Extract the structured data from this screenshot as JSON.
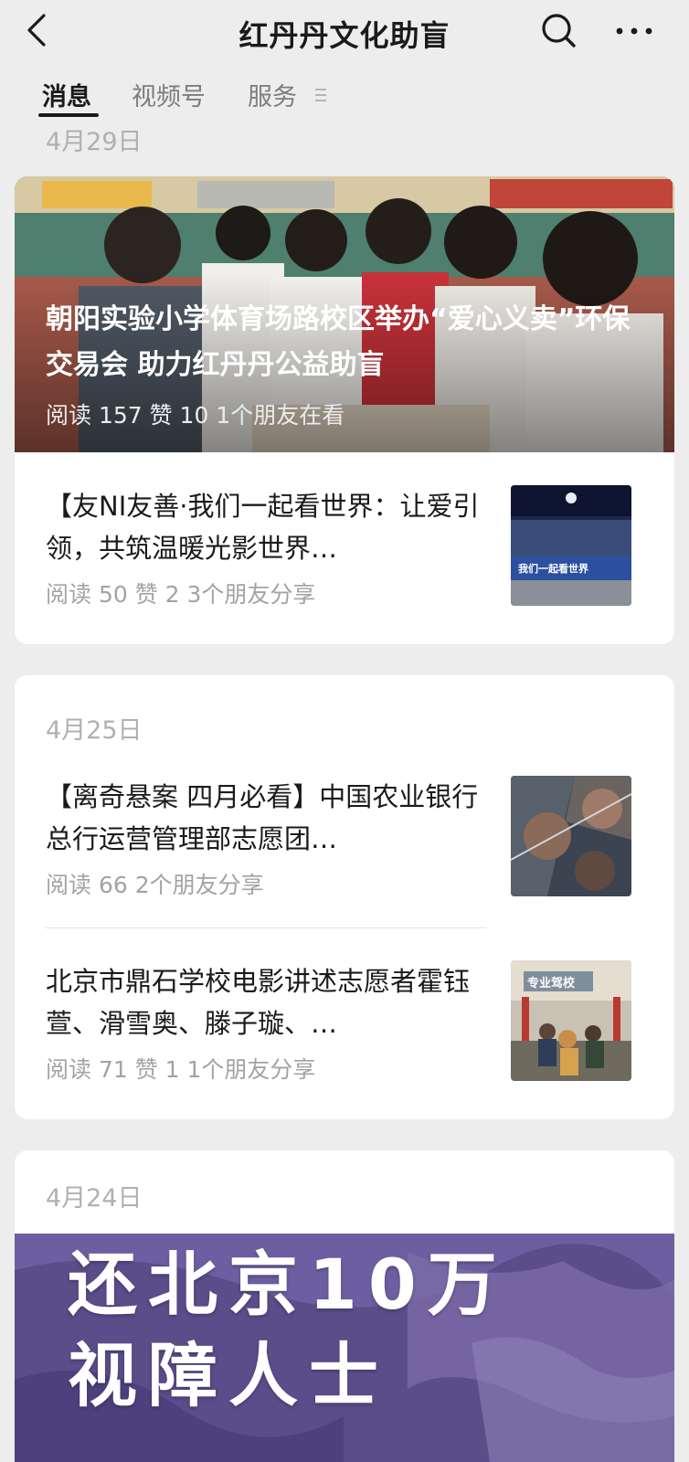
{
  "header": {
    "title": "红丹丹文化助盲",
    "back_icon": "chevron-left-icon",
    "search_icon": "search-icon",
    "more_icon": "more-dots-icon"
  },
  "tabs": [
    {
      "label": "消息",
      "active": true
    },
    {
      "label": "视频号",
      "active": false
    },
    {
      "label": "服务",
      "active": false
    }
  ],
  "feed": [
    {
      "date": "4月29日",
      "featured": {
        "title": "朝阳实验小学体育场路校区举办“爱心义卖”环保交易会 助力红丹丹公益助盲",
        "meta": "阅读 157  赞 10  1个朋友在看"
      },
      "articles": [
        {
          "title": "【友NI友善·我们一起看世界：让爱引领，共筑温暖光影世界…",
          "meta": "阅读 50  赞 2  3个朋友分享",
          "thumb_text": "我们一起看世界"
        }
      ]
    },
    {
      "date": "4月25日",
      "articles": [
        {
          "title": "【离奇悬案 四月必看】中国农业银行总行运营管理部志愿团…",
          "meta": "阅读 66  2个朋友分享"
        },
        {
          "title": "北京市鼎石学校电影讲述志愿者霍钰萱、滑雪奥、滕子璇、…",
          "meta": "阅读 71  赞 1  1个朋友分享",
          "thumb_text": "专业驾校"
        }
      ]
    },
    {
      "date": "4月24日",
      "banner": {
        "line1": "还北京10万",
        "line2": "视障人士"
      }
    }
  ],
  "colors": {
    "background": "#ededed",
    "card": "#ffffff",
    "meta_text": "#a3a3a3",
    "date_text": "#b0b0b0"
  }
}
